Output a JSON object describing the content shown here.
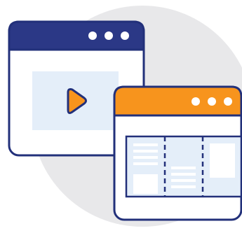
{
  "illustration": {
    "colors": {
      "background_circle": "#e8e8ea",
      "outline": "#22307a",
      "front_window_header": "#f7941d",
      "back_window_header": "#2b3886",
      "window_body": "#ffffff",
      "panel_fill": "#e4eef9",
      "play_icon": "#f7941d",
      "header_dots": "#ffffff"
    },
    "icons": {
      "video_window": "video-player-window-icon",
      "play": "play-icon",
      "board_window": "kanban-board-window-icon"
    }
  }
}
